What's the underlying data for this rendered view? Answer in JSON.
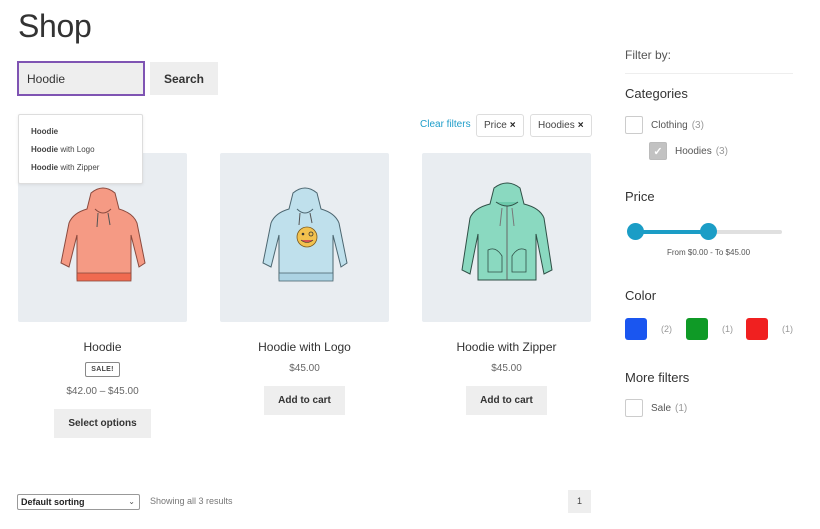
{
  "page": {
    "title": "Shop"
  },
  "search": {
    "value": "Hoodie",
    "button_label": "Search",
    "suggestions": [
      {
        "match": "Hoodie",
        "rest": ""
      },
      {
        "match": "Hoodie",
        "rest": " with Logo"
      },
      {
        "match": "Hoodie",
        "rest": " with Zipper"
      }
    ]
  },
  "active_filters": {
    "clear_label": "Clear filters",
    "chips": [
      {
        "label": "Price",
        "remove_icon": "×"
      },
      {
        "label": "Hoodies",
        "remove_icon": "×"
      }
    ]
  },
  "products": [
    {
      "name": "Hoodie",
      "badge": "SALE!",
      "price": "$42.00 – $45.00",
      "button": "Select options",
      "color": "#f08a74",
      "image": "hoodie-illustration"
    },
    {
      "name": "Hoodie with Logo",
      "badge": "",
      "price": "$45.00",
      "button": "Add to cart",
      "color": "#b8dbe8",
      "image": "hoodie-with-logo-illustration"
    },
    {
      "name": "Hoodie with Zipper",
      "badge": "",
      "price": "$45.00",
      "button": "Add to cart",
      "color": "#86d9bf",
      "image": "hoodie-with-zipper-illustration"
    }
  ],
  "footer": {
    "sorting": "Default sorting",
    "result_count": "Showing all 3 results",
    "page": "1"
  },
  "sidebar": {
    "filter_by": "Filter by:",
    "categories": {
      "heading": "Categories",
      "items": [
        {
          "label": "Clothing",
          "count": "(3)",
          "checked": false
        },
        {
          "label": "Hoodies",
          "count": "(3)",
          "checked": true
        }
      ]
    },
    "price": {
      "heading": "Price",
      "min_percent": 0,
      "max_percent": 50,
      "range_text": "From $0.00 - To $45.00",
      "accent": "#1b9dc6"
    },
    "color": {
      "heading": "Color",
      "swatches": [
        {
          "name": "Blue",
          "hex": "#1a56f0",
          "count": "(2)"
        },
        {
          "name": "Green",
          "hex": "#0f9a26",
          "count": "(1)"
        },
        {
          "name": "Red",
          "hex": "#f02020",
          "count": "(1)"
        }
      ]
    },
    "more_filters": {
      "heading": "More filters",
      "items": [
        {
          "label": "Sale",
          "count": "(1)",
          "checked": false
        }
      ]
    }
  }
}
